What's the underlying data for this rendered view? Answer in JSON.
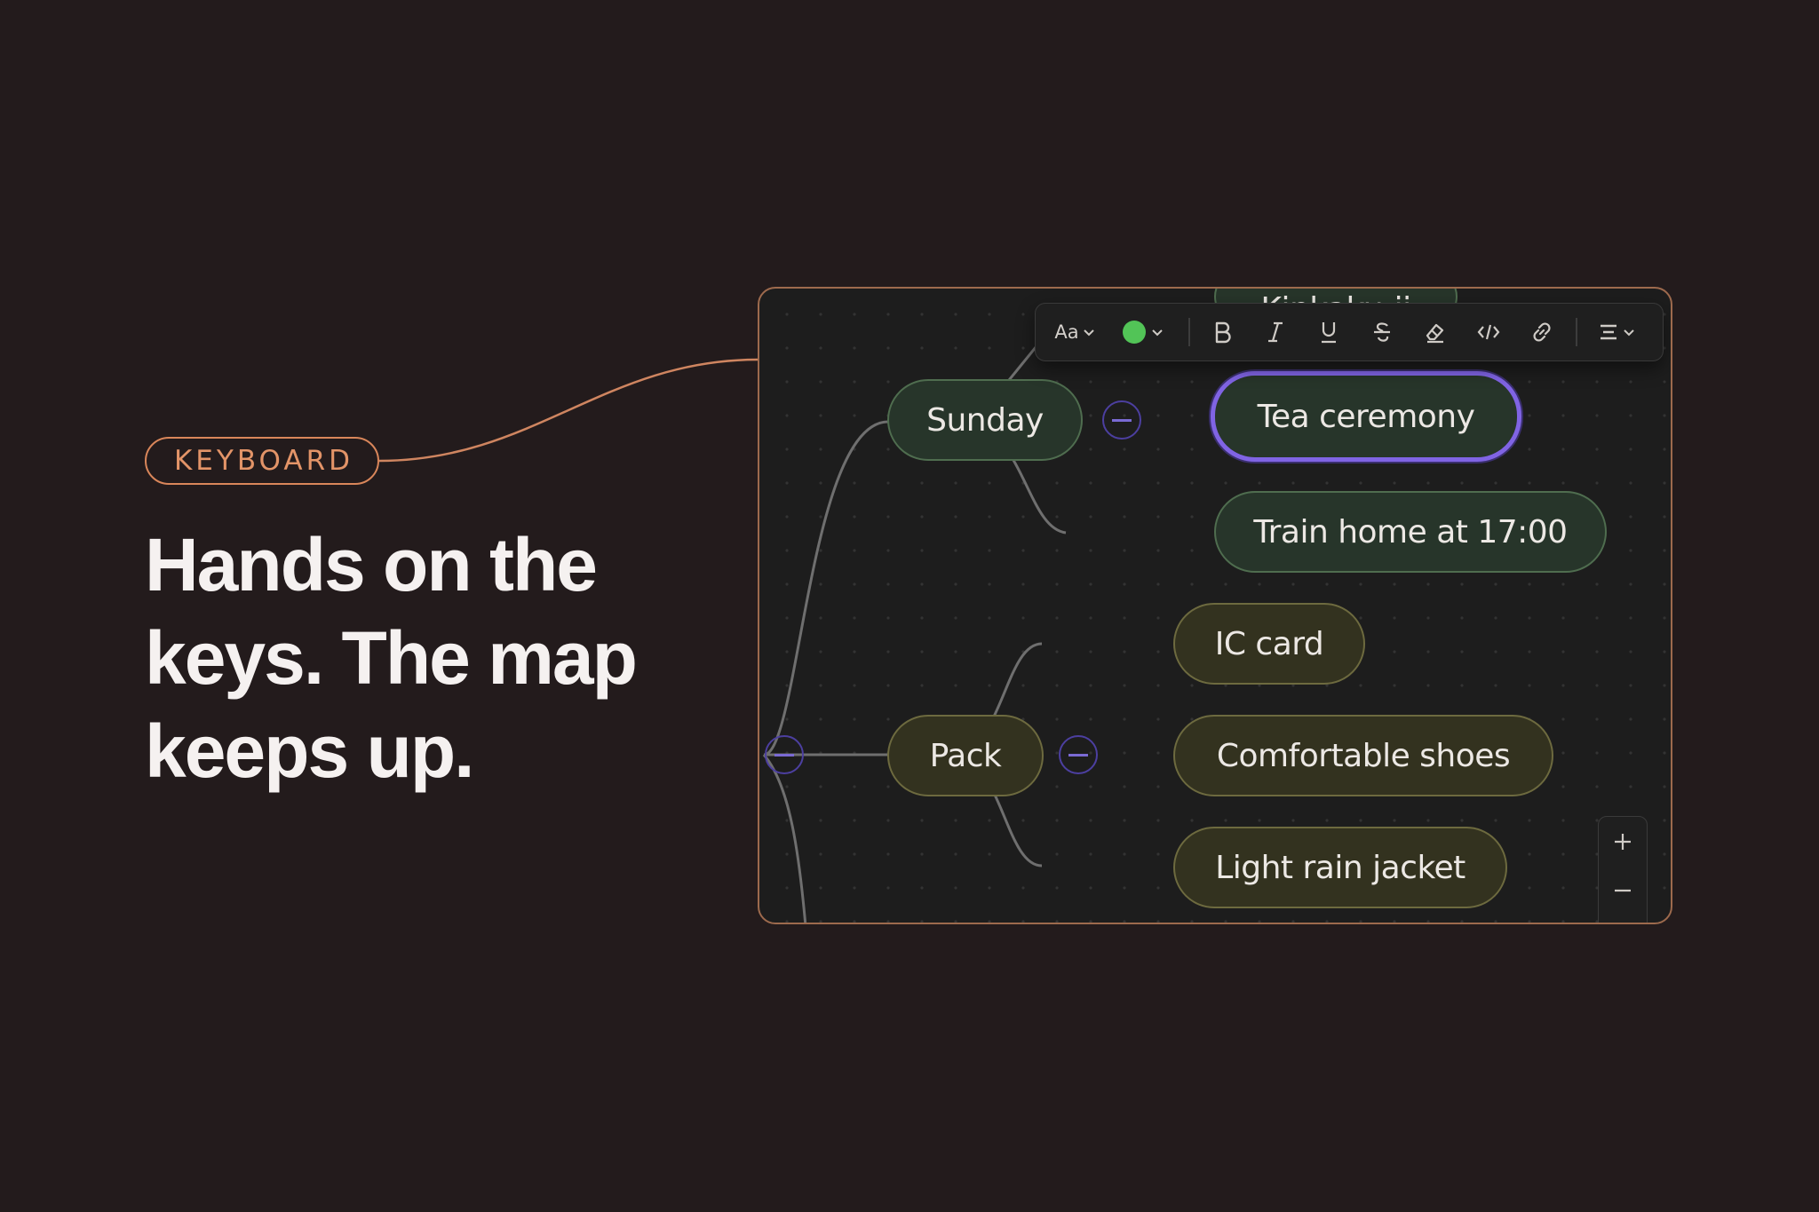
{
  "badge": {
    "label": "KEYBOARD"
  },
  "headline": {
    "lines": [
      "Hands on the",
      "keys. The map",
      "keeps up."
    ]
  },
  "colors": {
    "background": "#231b1c",
    "accent": "#e39468",
    "selection": "#8064e4",
    "node_green": "#27352a",
    "node_olive": "#33321f",
    "text_color_swatch": "#52c457"
  },
  "toolbar": {
    "font_label": "Aa",
    "icons": [
      "chevron-down-icon",
      "bold-icon",
      "italic-icon",
      "underline-icon",
      "strikethrough-icon",
      "eraser-icon",
      "code-icon",
      "link-icon",
      "align-icon"
    ]
  },
  "mindmap": {
    "partial_node": "Kinkaku-ji",
    "nodes": {
      "sunday": "Sunday",
      "tea": "Tea ceremony",
      "train": "Train home at 17:00",
      "pack": "Pack",
      "ic": "IC card",
      "shoes": "Comfortable shoes",
      "jacket": "Light rain jacket"
    },
    "selected": "Tea ceremony"
  },
  "zoom": {
    "in_icon": "plus-icon",
    "out_icon": "minus-icon"
  }
}
